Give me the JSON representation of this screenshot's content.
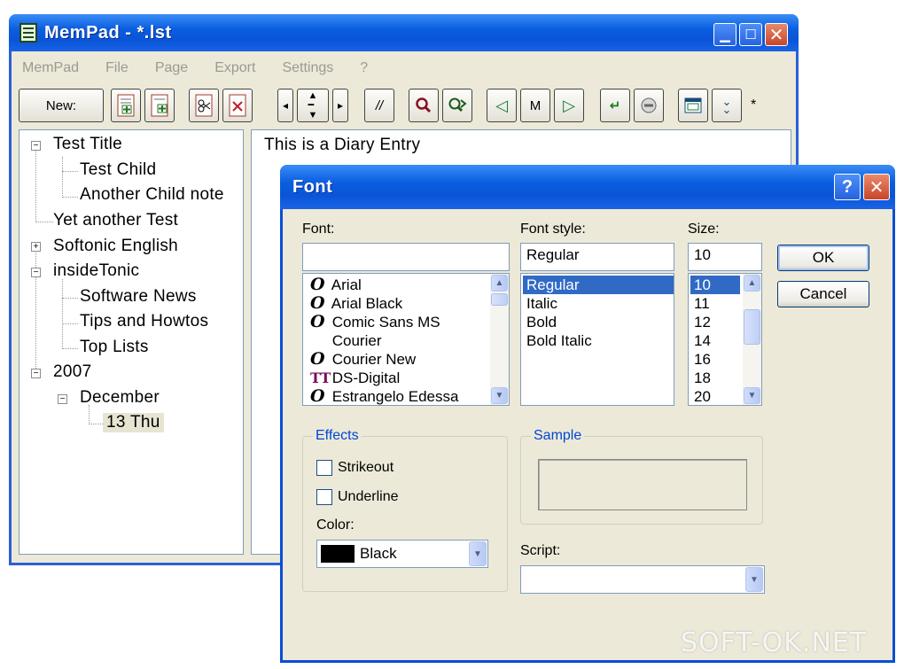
{
  "main_window": {
    "title": "MemPad - *.lst",
    "menu": [
      "MemPad",
      "File",
      "Page",
      "Export",
      "Settings",
      "?"
    ],
    "toolbar": {
      "new_label": "New:",
      "slash_label": "//",
      "m_label": "M",
      "modified_marker": "*",
      "icons": [
        "add-sibling-icon",
        "add-child-icon",
        "cut-icon",
        "delete-icon",
        "move-left-icon",
        "move-up-down-icon",
        "move-right-icon",
        "comment-icon",
        "search-icon",
        "search-next-icon",
        "back-icon",
        "bookmark-icon",
        "forward-icon",
        "undo-icon",
        "stop-icon",
        "window-icon",
        "more-icon"
      ]
    },
    "tree": [
      {
        "label": "Test Title",
        "expander": "−"
      },
      {
        "label": "Test Child"
      },
      {
        "label": "Another Child note"
      },
      {
        "label": "Yet another Test"
      },
      {
        "label": "Softonic English",
        "expander": "+"
      },
      {
        "label": "insideTonic",
        "expander": "−"
      },
      {
        "label": "Software News"
      },
      {
        "label": "Tips and Howtos"
      },
      {
        "label": "Top Lists"
      },
      {
        "label": "2007",
        "expander": "−"
      },
      {
        "label": "December",
        "expander": "−"
      },
      {
        "label": "13 Thu",
        "selected": true
      }
    ],
    "editor_text": "This is a Diary Entry"
  },
  "font_dialog": {
    "title": "Font",
    "help_label": "?",
    "font_label": "Font:",
    "font_value": "",
    "font_list": [
      {
        "name": "Arial",
        "icon": "O"
      },
      {
        "name": "Arial Black",
        "icon": "O"
      },
      {
        "name": "Comic Sans MS",
        "icon": "O"
      },
      {
        "name": "Courier",
        "icon": ""
      },
      {
        "name": "Courier New",
        "icon": "O"
      },
      {
        "name": "DS-Digital",
        "icon": "TT"
      },
      {
        "name": "Estrangelo Edessa",
        "icon": "O"
      }
    ],
    "style_label": "Font style:",
    "style_value": "Regular",
    "style_list": [
      "Regular",
      "Italic",
      "Bold",
      "Bold Italic"
    ],
    "style_selected": "Regular",
    "size_label": "Size:",
    "size_value": "10",
    "size_list": [
      "10",
      "11",
      "12",
      "14",
      "16",
      "18",
      "20"
    ],
    "size_selected": "10",
    "ok_label": "OK",
    "cancel_label": "Cancel",
    "effects_label": "Effects",
    "strikeout_label": "Strikeout",
    "strikeout_checked": false,
    "underline_label": "Underline",
    "underline_checked": false,
    "color_label": "Color:",
    "color_value": "Black",
    "color_swatch": "#000000",
    "sample_label": "Sample",
    "script_label": "Script:",
    "script_value": ""
  },
  "watermark": "SOFT-OK.NET",
  "colors": {
    "title_bar": "#0a5ee0",
    "selection": "#316ac5",
    "dialog_bg": "#ece9d8",
    "group_caption": "#0046d5"
  }
}
